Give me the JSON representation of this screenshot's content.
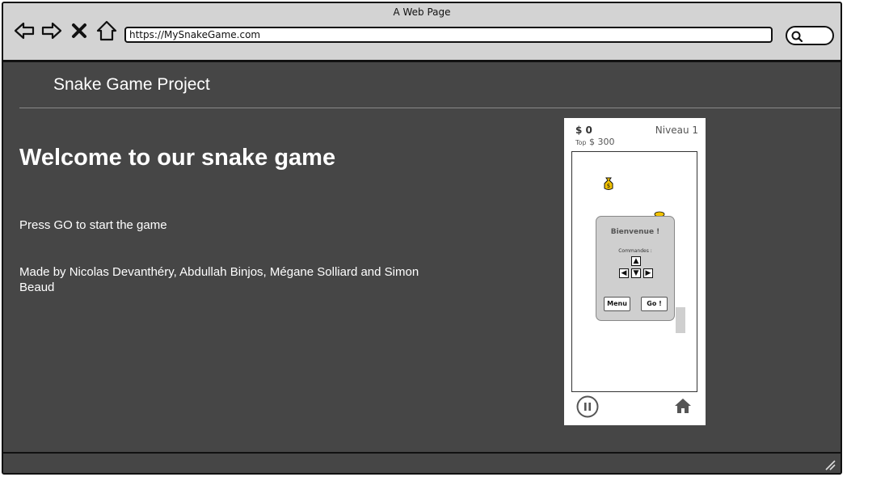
{
  "browser": {
    "window_title": "A Web Page",
    "url": "https://MySnakeGame.com",
    "nav_icons": [
      "back-arrow-icon",
      "forward-arrow-icon",
      "stop-icon",
      "home-icon"
    ],
    "search_icon": "search-icon"
  },
  "page": {
    "site_title": "Snake Game Project",
    "heading": "Welcome to our snake game",
    "instruction": "Press GO to start the game",
    "credits": "Made by Nicolas Devanthéry, Abdullah Binjos, Mégane Solliard and Simon Beaud"
  },
  "game": {
    "money": "$ 0",
    "top_label": "Top",
    "top_score": "$ 300",
    "level": "Niveau 1",
    "dialog": {
      "title": "Bienvenue !",
      "commands_label": "Commandes :",
      "keys": [
        "up-key",
        "left-key",
        "down-key",
        "right-key"
      ],
      "menu_label": "Menu",
      "go_label": "Go !"
    },
    "bottom_icons": [
      "pause-icon",
      "home-icon"
    ]
  },
  "colors": {
    "page_background": "#464646",
    "browser_chrome": "#d3d3d3",
    "dialog_background": "#cfcfcf",
    "coin": "#f2c200"
  }
}
